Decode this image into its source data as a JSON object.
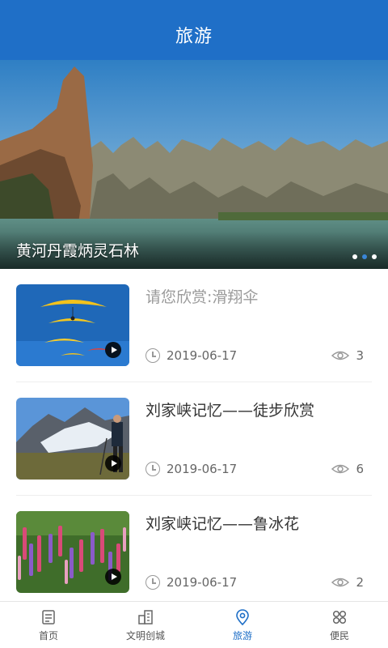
{
  "header": {
    "title": "旅游"
  },
  "banner": {
    "caption": "黄河丹霞炳灵石林",
    "slide_count": 3,
    "active_slide": 1
  },
  "articles": [
    {
      "title": "请您欣赏:滑翔伞",
      "date": "2019-06-17",
      "views": "3",
      "muted": true,
      "thumb": "paragliders-icon"
    },
    {
      "title": "刘家峡记忆——徒步欣赏",
      "date": "2019-06-17",
      "views": "6",
      "muted": false,
      "thumb": "hiker-glacier-icon"
    },
    {
      "title": "刘家峡记忆——鲁冰花",
      "date": "2019-06-17",
      "views": "2",
      "muted": false,
      "thumb": "lupine-flowers-icon"
    }
  ],
  "tabbar": {
    "tabs": [
      {
        "label": "首页",
        "icon": "home-icon"
      },
      {
        "label": "文明创城",
        "icon": "city-icon"
      },
      {
        "label": "旅游",
        "icon": "location-pin-icon",
        "active": true
      },
      {
        "label": "便民",
        "icon": "grid-icon"
      }
    ]
  },
  "colors": {
    "primary": "#1f6fc7",
    "text": "#333333",
    "muted": "#9a9a9a"
  }
}
